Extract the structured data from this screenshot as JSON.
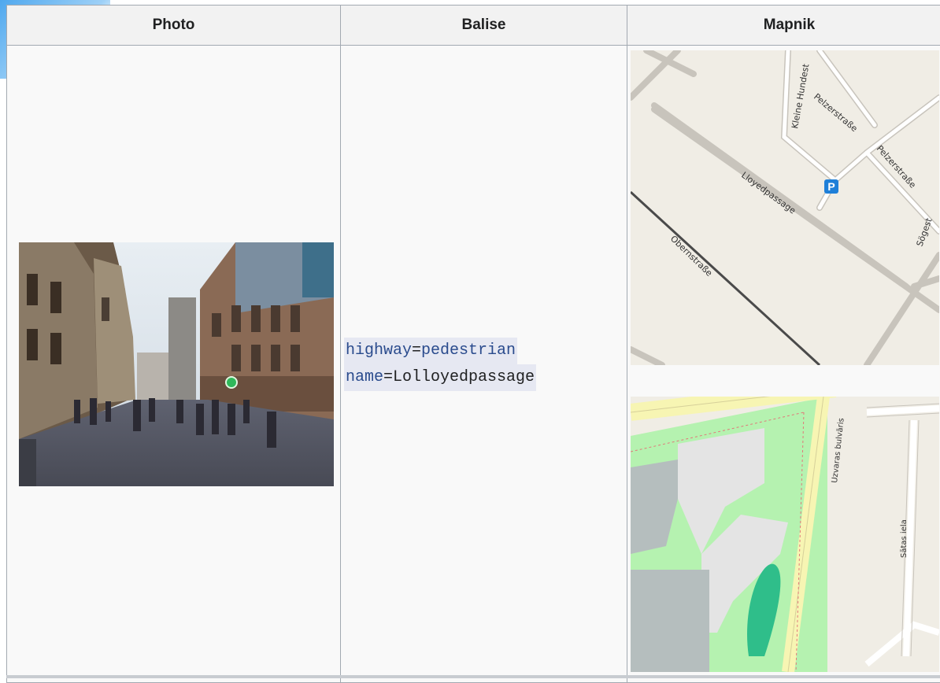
{
  "table": {
    "headers": [
      "Photo",
      "Balise",
      "Mapnik"
    ]
  },
  "tags": [
    {
      "key": "highway",
      "eq": "=",
      "value": "pedestrian",
      "value_linked": true
    },
    {
      "key": "name",
      "eq": "=",
      "value": "Lolloyedpassage",
      "value_linked": false
    }
  ],
  "map1": {
    "labels": [
      "Kleine Hundest",
      "Pelzerstraße",
      "Pelzerstraße",
      "Lloyedpassage",
      "Obernstraße",
      "Sögest"
    ],
    "parking_symbol": "P"
  },
  "map2": {
    "labels": [
      "Uzvaras bulvāris",
      "Sātas iela"
    ]
  },
  "colors": {
    "header_bg": "#f2f2f2",
    "cell_bg": "#f9f9f9",
    "border": "#a2a9b1",
    "link": "#2a4b8d",
    "map_bg": "#f0ede5",
    "park_green": "#b5f2b0"
  }
}
